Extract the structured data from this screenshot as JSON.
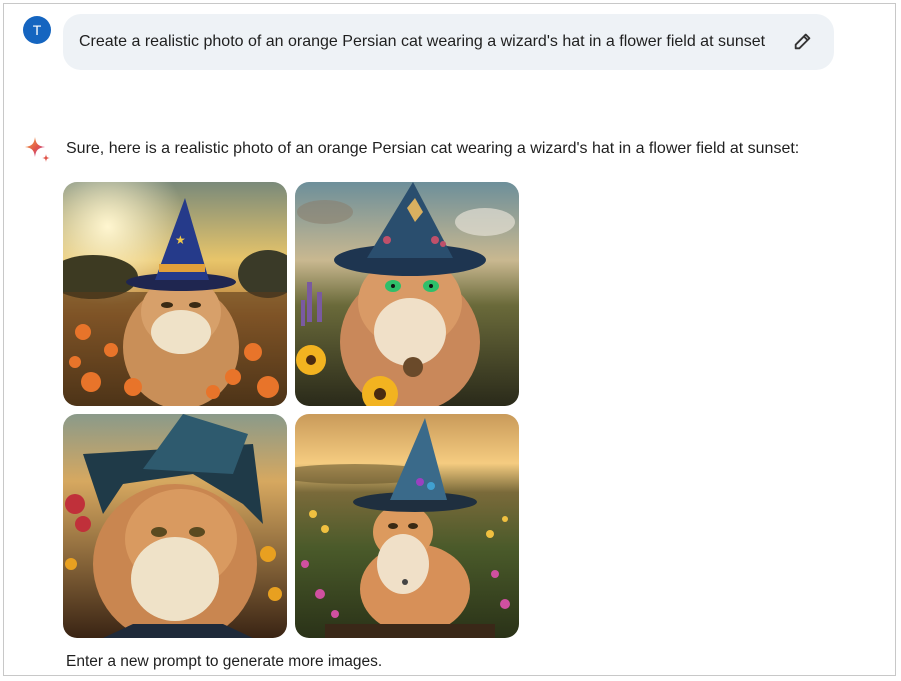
{
  "user": {
    "avatar_letter": "T"
  },
  "prompt": {
    "text": "Create a realistic photo of an orange Persian cat wearing a wizard's hat in a flower field at sunset"
  },
  "response": {
    "text": "Sure, here is a realistic photo of an orange Persian cat wearing a wizard's hat in a flower field at sunset:",
    "footer": "Enter a new prompt to generate more images."
  },
  "colors": {
    "avatar": "#1565c0",
    "bubble": "#eef2f6",
    "sparkle_blue": "#4a7bd0",
    "sparkle_red": "#e0554a"
  },
  "icons": {
    "edit": "pencil-icon",
    "assistant": "sparkle-icon"
  }
}
